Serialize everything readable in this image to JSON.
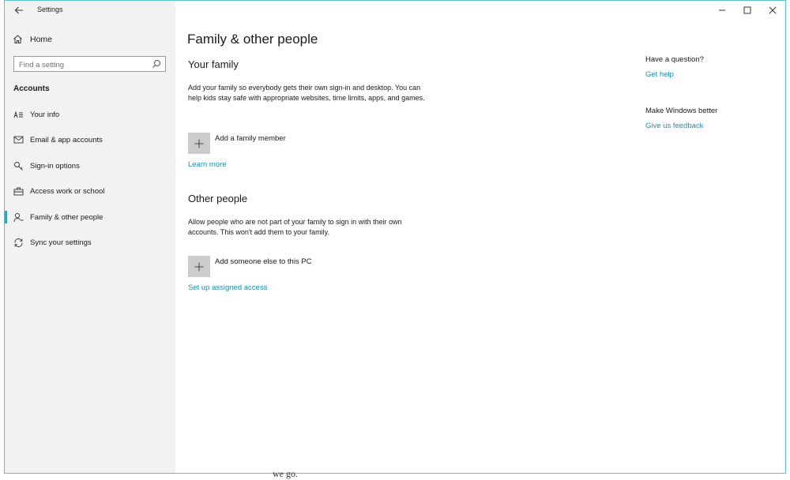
{
  "window": {
    "title": "Settings",
    "controls": {
      "minimize_icon": "minimize-icon",
      "maximize_icon": "maximize-icon",
      "close_icon": "close-icon"
    }
  },
  "sidebar": {
    "home_label": "Home",
    "search": {
      "placeholder": "Find a setting",
      "value": ""
    },
    "section_label": "Accounts",
    "items": [
      {
        "label": "Your info",
        "icon": "contact-card-icon",
        "active": false
      },
      {
        "label": "Email & app accounts",
        "icon": "mail-icon",
        "active": false
      },
      {
        "label": "Sign-in options",
        "icon": "key-icon",
        "active": false
      },
      {
        "label": "Access work or school",
        "icon": "briefcase-icon",
        "active": false
      },
      {
        "label": "Family & other people",
        "icon": "person-add-icon",
        "active": true
      },
      {
        "label": "Sync your settings",
        "icon": "sync-icon",
        "active": false
      }
    ]
  },
  "main": {
    "page_title": "Family & other people",
    "your_family": {
      "heading": "Your family",
      "description": "Add your family so everybody gets their own sign-in and desktop. You can help kids stay safe with appropriate websites, time limits, apps, and games.",
      "add_label": "Add a family member",
      "link": "Learn more"
    },
    "other_people": {
      "heading": "Other people",
      "description": "Allow people who are not part of your family to sign in with their own accounts. This won't add them to your family.",
      "add_label": "Add someone else to this PC",
      "link": "Set up assigned access"
    }
  },
  "aside": {
    "question_heading": "Have a question?",
    "question_link": "Get help",
    "better_heading": "Make Windows better",
    "better_link": "Give us feedback"
  },
  "overflow_text": "we go."
}
